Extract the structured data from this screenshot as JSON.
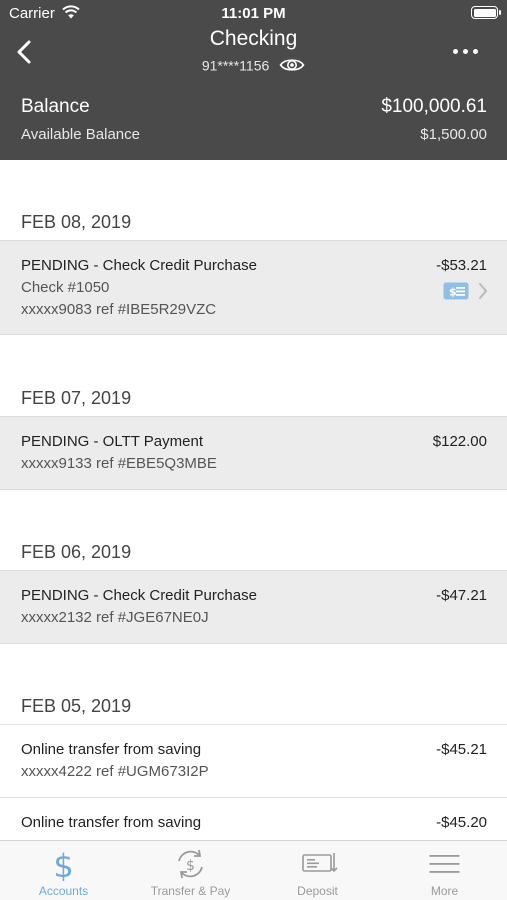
{
  "status_bar": {
    "carrier": "Carrier",
    "time": "11:01 PM"
  },
  "nav": {
    "title": "Checking",
    "account_number": "91****1156"
  },
  "balance": {
    "label": "Balance",
    "value": "$100,000.61",
    "available_label": "Available Balance",
    "available_value": "$1,500.00"
  },
  "groups": [
    {
      "date": "FEB 08, 2019",
      "transactions": [
        {
          "description": "PENDING - Check Credit Purchase",
          "check": "Check #1050",
          "ref": "xxxxx9083 ref #IBE5R29VZC",
          "amount": "-$53.21"
        }
      ]
    },
    {
      "date": "FEB 07, 2019",
      "transactions": [
        {
          "description": "PENDING - OLTT Payment",
          "ref": "xxxxx9133 ref #EBE5Q3MBE",
          "amount": "$122.00"
        }
      ]
    },
    {
      "date": "FEB 06, 2019",
      "transactions": [
        {
          "description": "PENDING - Check Credit Purchase",
          "ref": "xxxxx2132 ref #JGE67NE0J",
          "amount": "-$47.21"
        }
      ]
    },
    {
      "date": "FEB 05, 2019",
      "transactions": [
        {
          "description": "Online transfer from saving",
          "ref": "xxxxx4222 ref #UGM673I2P",
          "amount": "-$45.21"
        },
        {
          "description": "Online transfer from saving",
          "ref": "",
          "amount": "-$45.20"
        }
      ]
    }
  ],
  "tabs": [
    {
      "label": "Accounts",
      "icon": "dollar-icon",
      "active": true
    },
    {
      "label": "Transfer & Pay",
      "icon": "transfer-cycle-icon",
      "active": false
    },
    {
      "label": "Deposit",
      "icon": "check-deposit-icon",
      "active": false
    },
    {
      "label": "More",
      "icon": "menu-lines-icon",
      "active": false
    }
  ],
  "colors": {
    "header_bg": "#4a4a4a",
    "accent": "#6ea9d8",
    "pending_row_bg": "#ececec"
  }
}
